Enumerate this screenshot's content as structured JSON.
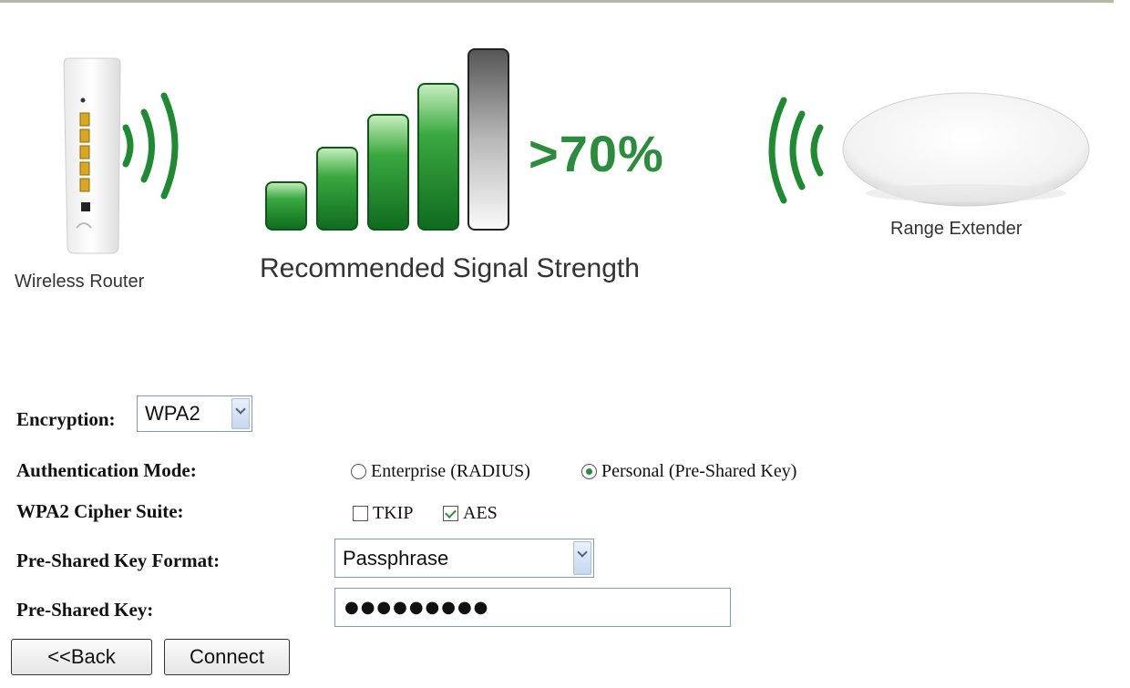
{
  "diagram": {
    "router_label": "Wireless Router",
    "signal_percent": ">70%",
    "signal_label": "Recommended Signal Strength",
    "extender_label": "Range Extender",
    "signal_bars_filled": 4,
    "signal_bars_total": 5
  },
  "colors": {
    "accent_green": "#2a8c3c",
    "divider": "#b8b8a8"
  },
  "form": {
    "encryption": {
      "label": "Encryption:",
      "value": "WPA2"
    },
    "auth_mode": {
      "label": "Authentication Mode:",
      "options": [
        "Enterprise (RADIUS)",
        "Personal (Pre-Shared Key)"
      ],
      "selected": "Personal (Pre-Shared Key)"
    },
    "cipher": {
      "label": "WPA2 Cipher Suite:",
      "options": [
        {
          "label": "TKIP",
          "checked": false
        },
        {
          "label": "AES",
          "checked": true
        }
      ]
    },
    "psk_format": {
      "label": "Pre-Shared Key Format:",
      "value": "Passphrase"
    },
    "psk": {
      "label": "Pre-Shared Key:",
      "value": "●●●●●●●●●"
    }
  },
  "buttons": {
    "back": "<<Back",
    "connect": "Connect"
  }
}
